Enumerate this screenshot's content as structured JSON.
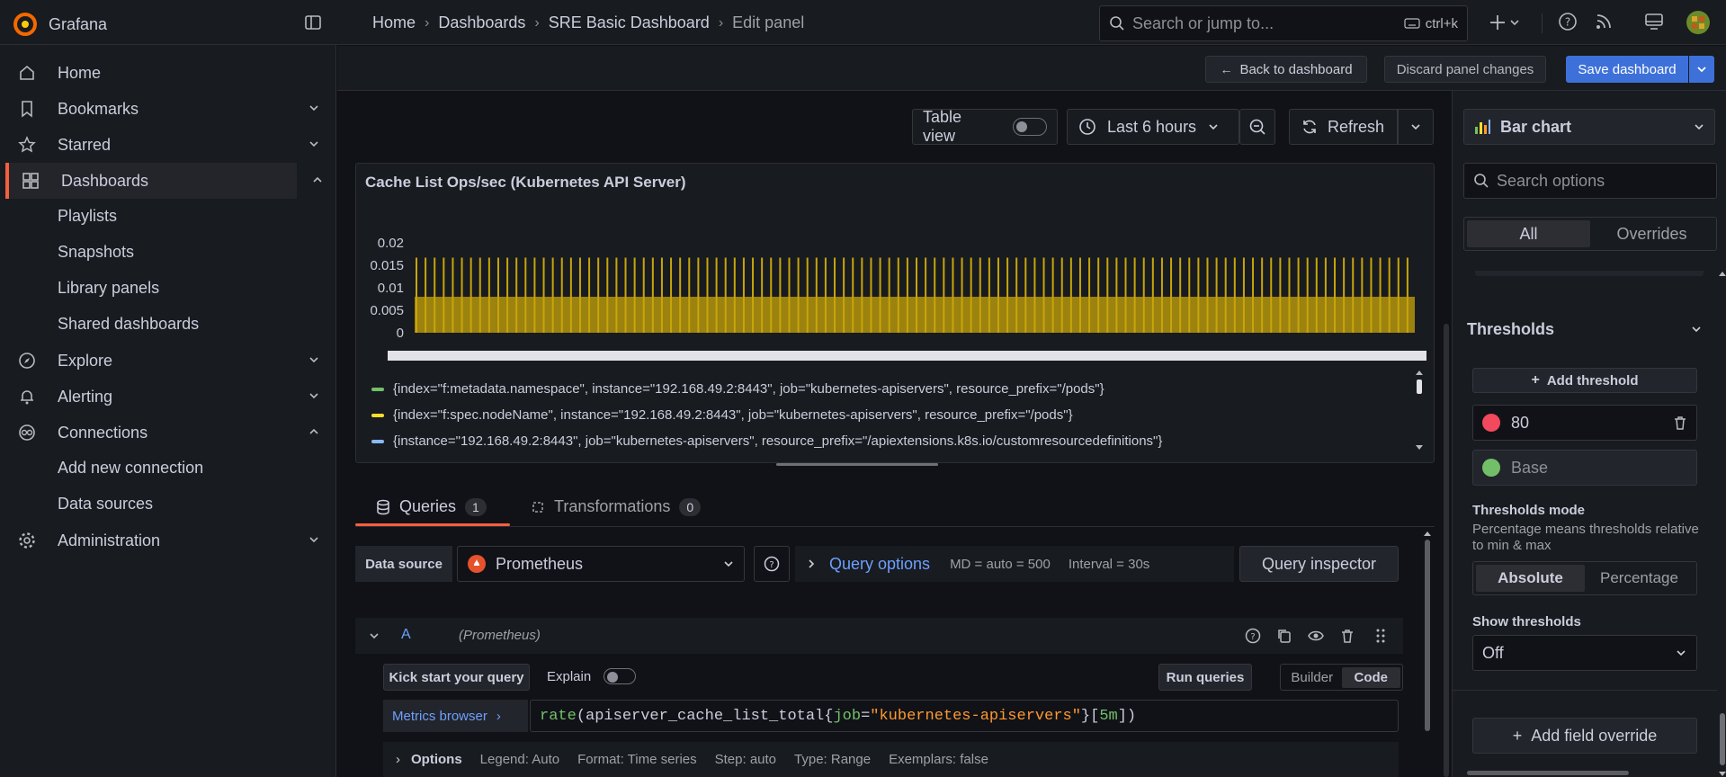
{
  "topbar": {
    "app_name": "Grafana",
    "breadcrumbs": [
      "Home",
      "Dashboards",
      "SRE Basic Dashboard",
      "Edit panel"
    ],
    "search_placeholder": "Search or jump to...",
    "search_shortcut": "ctrl+k"
  },
  "sidebar": {
    "items": [
      {
        "label": "Home",
        "icon": "home-icon"
      },
      {
        "label": "Bookmarks",
        "icon": "bookmark-icon"
      },
      {
        "label": "Starred",
        "icon": "star-icon"
      },
      {
        "label": "Dashboards",
        "icon": "apps-icon"
      },
      {
        "label": "Explore",
        "icon": "compass-icon"
      },
      {
        "label": "Alerting",
        "icon": "bell-icon"
      },
      {
        "label": "Connections",
        "icon": "link-icon"
      },
      {
        "label": "Administration",
        "icon": "gear-icon"
      }
    ],
    "dashboards_sub": [
      "Playlists",
      "Snapshots",
      "Library panels",
      "Shared dashboards"
    ],
    "connections_sub": [
      "Add new connection",
      "Data sources"
    ]
  },
  "actionbar": {
    "back": "Back to dashboard",
    "discard": "Discard panel changes",
    "save": "Save dashboard"
  },
  "toolbar": {
    "table_view": "Table view",
    "time_range": "Last 6 hours",
    "refresh": "Refresh"
  },
  "panel": {
    "title": "Cache List Ops/sec (Kubernetes API Server)",
    "legend": [
      {
        "label": "{index=\"f:metadata.namespace\", instance=\"192.168.49.2:8443\", job=\"kubernetes-apiservers\", resource_prefix=\"/pods\"}",
        "color": "#73bf69"
      },
      {
        "label": "{index=\"f:spec.nodeName\", instance=\"192.168.49.2:8443\", job=\"kubernetes-apiservers\", resource_prefix=\"/pods\"}",
        "color": "#fade2a"
      },
      {
        "label": "{instance=\"192.168.49.2:8443\", job=\"kubernetes-apiservers\", resource_prefix=\"/apiextensions.k8s.io/customresourcedefinitions\"}",
        "color": "#8ab8ff"
      }
    ]
  },
  "chart_data": {
    "type": "bar",
    "title": "Cache List Ops/sec (Kubernetes API Server)",
    "y_ticks": [
      "0.02",
      "0.015",
      "0.01",
      "0.005",
      "0"
    ],
    "ylim": [
      0,
      0.022
    ],
    "base_value": 0.008,
    "peak_value": 0.0167,
    "bar_count": 110,
    "bar_color": "#c8a50a"
  },
  "queries": {
    "tab_queries": "Queries",
    "tab_queries_count": "1",
    "tab_transformations": "Transformations",
    "tab_transformations_count": "0",
    "datasource_label": "Data source",
    "datasource": "Prometheus",
    "query_options": "Query options",
    "md": "MD = auto = 500",
    "interval": "Interval = 30s",
    "inspector": "Query inspector",
    "query_ref": "A",
    "query_ds": "(Prometheus)",
    "kick_start": "Kick start your query",
    "explain": "Explain",
    "run": "Run queries",
    "builder": "Builder",
    "code": "Code",
    "metrics_browser": "Metrics browser",
    "expr_fn": "rate",
    "expr_metric": "apiserver_cache_list_total",
    "expr_label": "job",
    "expr_value": "\"kubernetes-apiservers\"",
    "expr_range": "5m",
    "options_label": "Options",
    "opt_legend": "Legend: Auto",
    "opt_format": "Format: Time series",
    "opt_step": "Step: auto",
    "opt_type": "Type: Range",
    "opt_exemplars": "Exemplars: false"
  },
  "options": {
    "viz": "Bar chart",
    "search_placeholder": "Search options",
    "tab_all": "All",
    "tab_overrides": "Overrides",
    "thresholds_title": "Thresholds",
    "add_threshold": "Add threshold",
    "threshold_value": "80",
    "threshold_base": "Base",
    "mode_title": "Thresholds mode",
    "mode_desc": "Percentage means thresholds relative to min & max",
    "mode_absolute": "Absolute",
    "mode_percentage": "Percentage",
    "show_title": "Show thresholds",
    "show_value": "Off",
    "add_override": "Add field override"
  }
}
